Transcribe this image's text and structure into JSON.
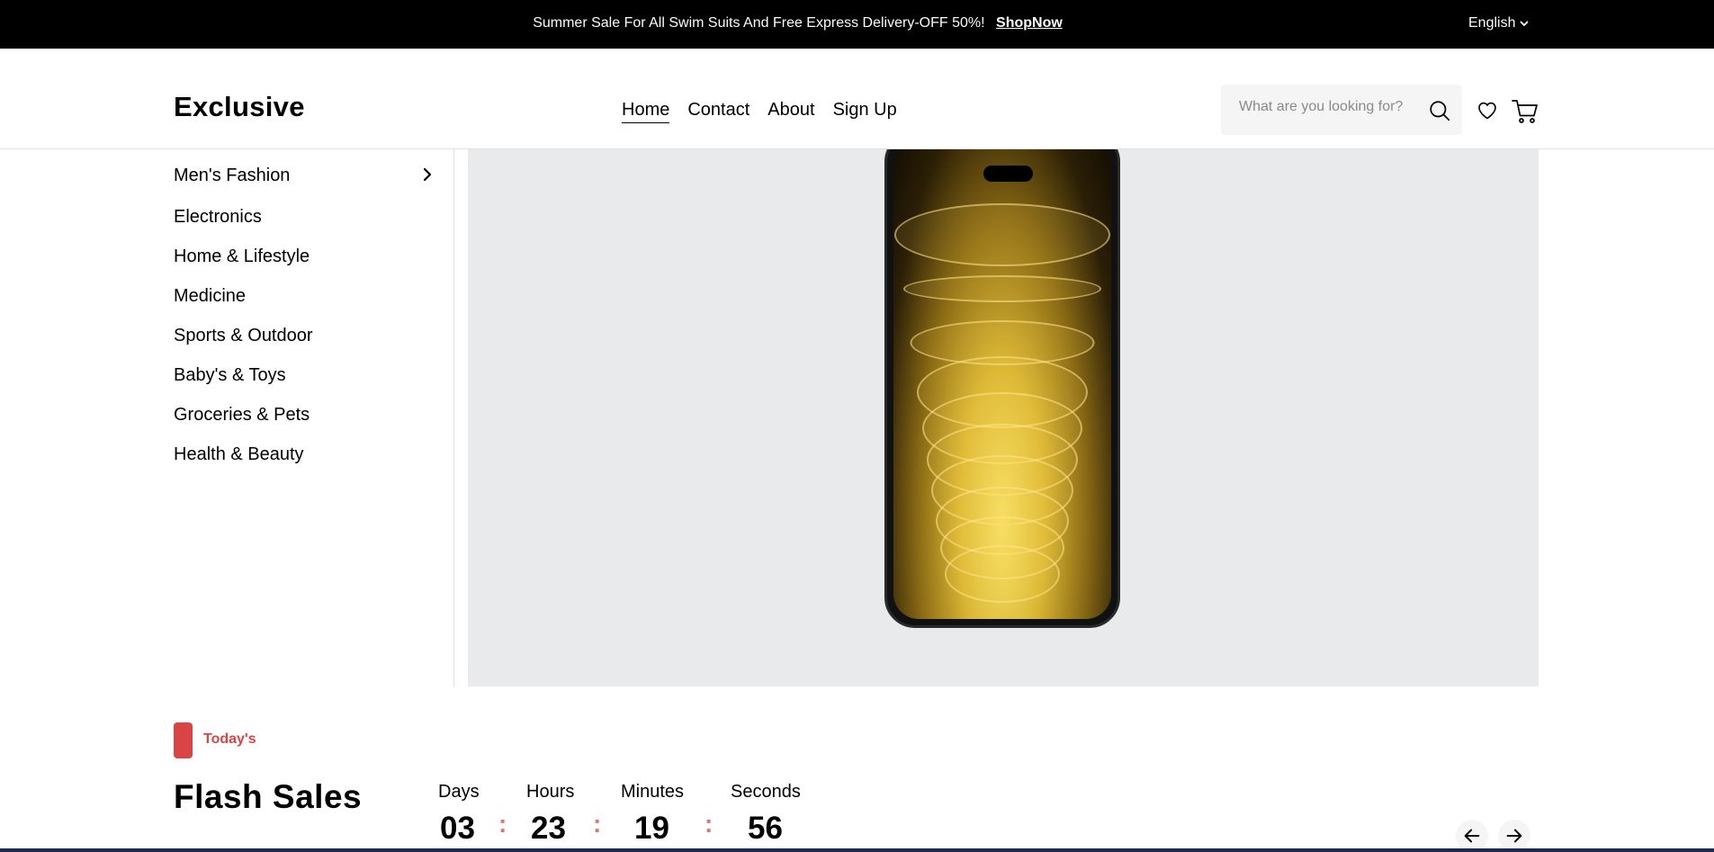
{
  "topbar": {
    "promo_text": "Summer Sale For All Swim Suits And Free Express Delivery-OFF 50%!",
    "promo_link": "ShopNow",
    "language": "English"
  },
  "header": {
    "logo": "Exclusive",
    "nav": [
      "Home",
      "Contact",
      "About",
      "Sign Up"
    ],
    "active_nav": "Home",
    "search_placeholder": "What are you looking for?",
    "icons": [
      "search-icon",
      "heart-icon",
      "cart-icon"
    ]
  },
  "sidebar": {
    "categories": [
      "Men's Fashion",
      "Electronics",
      "Home & Lifestyle",
      "Medicine",
      "Sports & Outdoor",
      "Baby's & Toys",
      "Groceries & Pets",
      "Health & Beauty"
    ]
  },
  "flash": {
    "tag": "Today's",
    "title": "Flash Sales",
    "timer": {
      "labels": [
        "Days",
        "Hours",
        "Minutes",
        "Seconds"
      ],
      "values": [
        "03",
        "23",
        "19",
        "56"
      ],
      "separator": ":"
    }
  },
  "colors": {
    "accent": "#DB4444",
    "topbar_bg": "#000000",
    "hero_bg": "#E9EAEB"
  }
}
